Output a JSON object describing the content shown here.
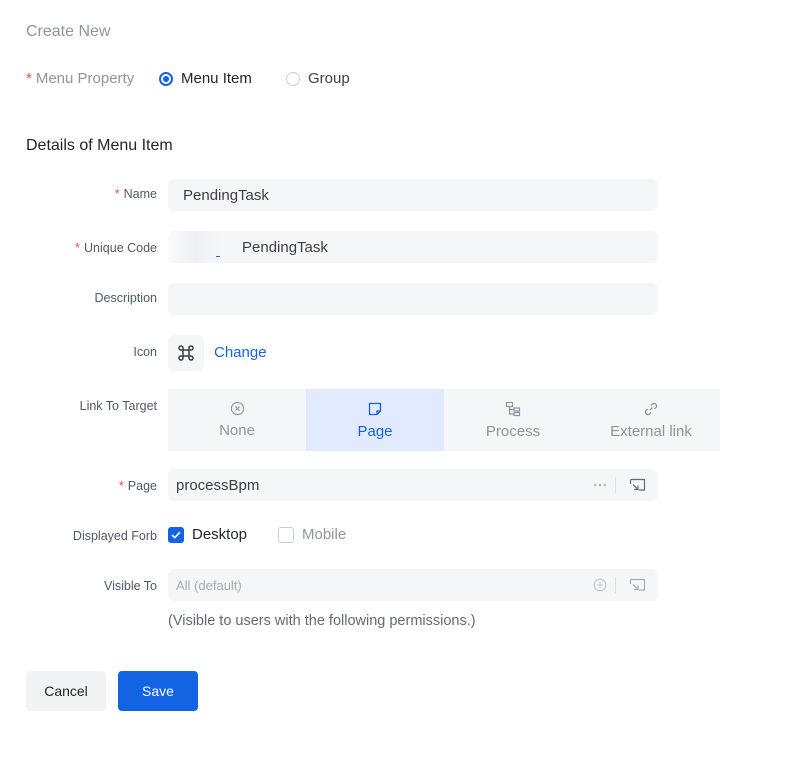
{
  "page": {
    "title": "Create New"
  },
  "menu_property": {
    "label": "Menu Property",
    "options": [
      {
        "label": "Menu Item",
        "selected": true
      },
      {
        "label": "Group",
        "selected": false
      }
    ]
  },
  "details": {
    "section_title": "Details of Menu Item",
    "name": {
      "label": "Name",
      "value": "PendingTask"
    },
    "unique_code": {
      "label": "Unique Code",
      "value": "PendingTask"
    },
    "description": {
      "label": "Description",
      "value": ""
    },
    "icon": {
      "label": "Icon",
      "change_label": "Change",
      "icon_name": "command-icon"
    },
    "link_to_target": {
      "label": "Link To Target",
      "options": [
        {
          "label": "None",
          "icon": "close-circle-icon",
          "active": false
        },
        {
          "label": "Page",
          "icon": "page-icon",
          "active": true
        },
        {
          "label": "Process",
          "icon": "process-icon",
          "active": false
        },
        {
          "label": "External link",
          "icon": "link-icon",
          "active": false
        }
      ]
    },
    "page_field": {
      "label": "Page",
      "value": "processBpm"
    },
    "displayed_form": {
      "label": "Displayed Forb",
      "options": [
        {
          "label": "Desktop",
          "checked": true
        },
        {
          "label": "Mobile",
          "checked": false
        }
      ]
    },
    "visible_to": {
      "label": "Visible To",
      "placeholder": "All (default)",
      "hint": "(Visible to users with the following permissions.)"
    }
  },
  "footer": {
    "cancel_label": "Cancel",
    "save_label": "Save"
  },
  "colors": {
    "primary": "#1264e3",
    "required": "#f54a45",
    "field_bg": "#f5f6f7",
    "active_seg_bg": "#e1eaff"
  }
}
